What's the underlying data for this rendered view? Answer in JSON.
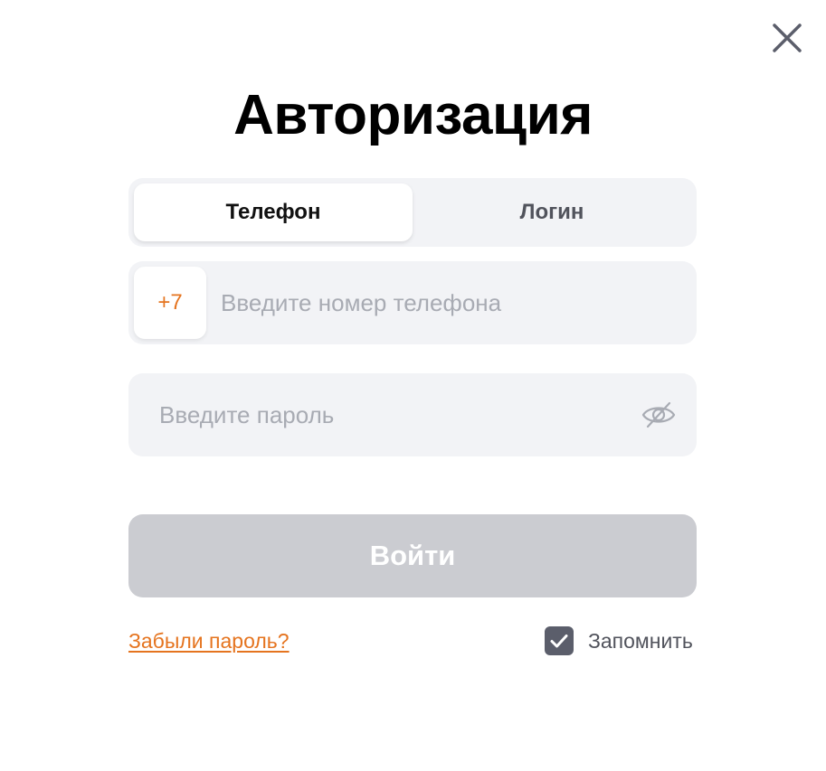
{
  "dialog": {
    "title": "Авторизация",
    "close_icon": "close-icon"
  },
  "tabs": [
    {
      "label": "Телефон",
      "active": true
    },
    {
      "label": "Логин",
      "active": false
    }
  ],
  "phone": {
    "country_code": "+7",
    "value": "",
    "placeholder": "Введите номер телефона"
  },
  "password": {
    "value": "",
    "placeholder": "Введите пароль",
    "toggle_icon": "eye-off-icon"
  },
  "submit": {
    "label": "Войти",
    "enabled": false
  },
  "forgot": {
    "label": "Забыли пароль?"
  },
  "remember": {
    "label": "Запомнить",
    "checked": true
  },
  "colors": {
    "accent": "#e5741f",
    "field_bg": "#f2f3f6",
    "button_disabled": "#cbccd1",
    "checkbox": "#5b5e6b",
    "placeholder": "#a8abb3"
  }
}
